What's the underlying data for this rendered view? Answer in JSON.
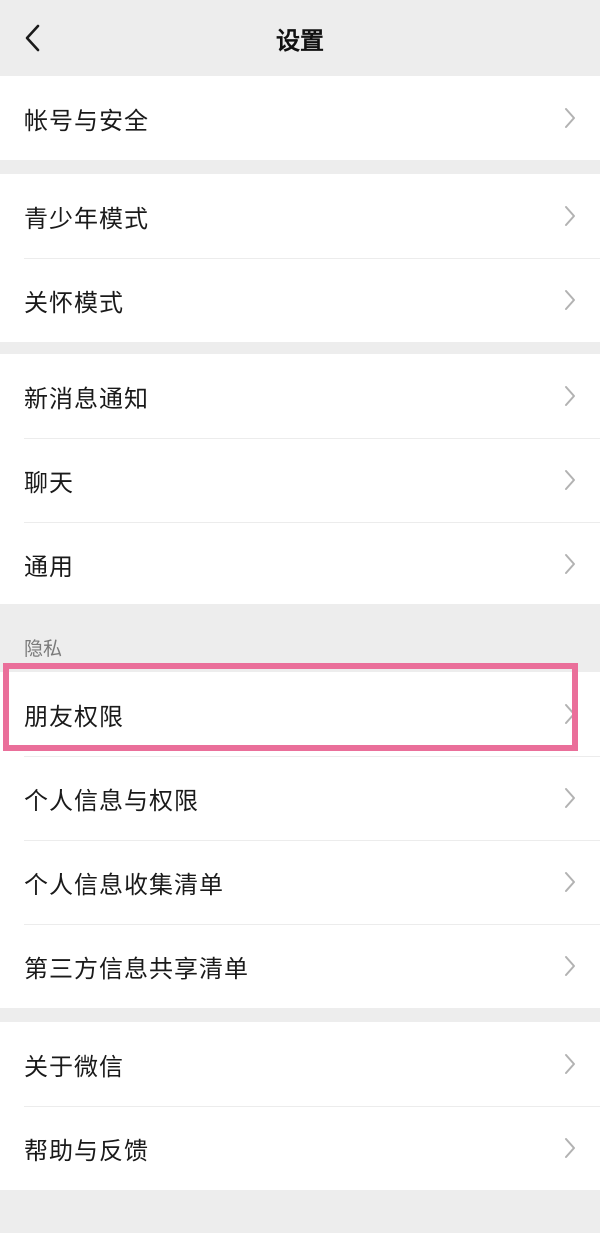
{
  "nav": {
    "title": "设置"
  },
  "groups": [
    {
      "items": [
        {
          "label": "帐号与安全"
        }
      ]
    },
    {
      "items": [
        {
          "label": "青少年模式"
        },
        {
          "label": "关怀模式"
        }
      ]
    },
    {
      "items": [
        {
          "label": "新消息通知"
        },
        {
          "label": "聊天"
        },
        {
          "label": "通用"
        }
      ]
    },
    {
      "header": "隐私",
      "items": [
        {
          "label": "朋友权限"
        },
        {
          "label": "个人信息与权限"
        },
        {
          "label": "个人信息收集清单"
        },
        {
          "label": "第三方信息共享清单"
        }
      ]
    },
    {
      "items": [
        {
          "label": "关于微信"
        },
        {
          "label": "帮助与反馈"
        }
      ]
    }
  ],
  "colors": {
    "background": "#ededed",
    "row_background": "#ffffff",
    "highlight_border": "#ea6f9a",
    "chevron": "#b2b2b2"
  },
  "icons": {
    "back": "chevron-left-icon",
    "row_arrow": "chevron-right-icon"
  }
}
